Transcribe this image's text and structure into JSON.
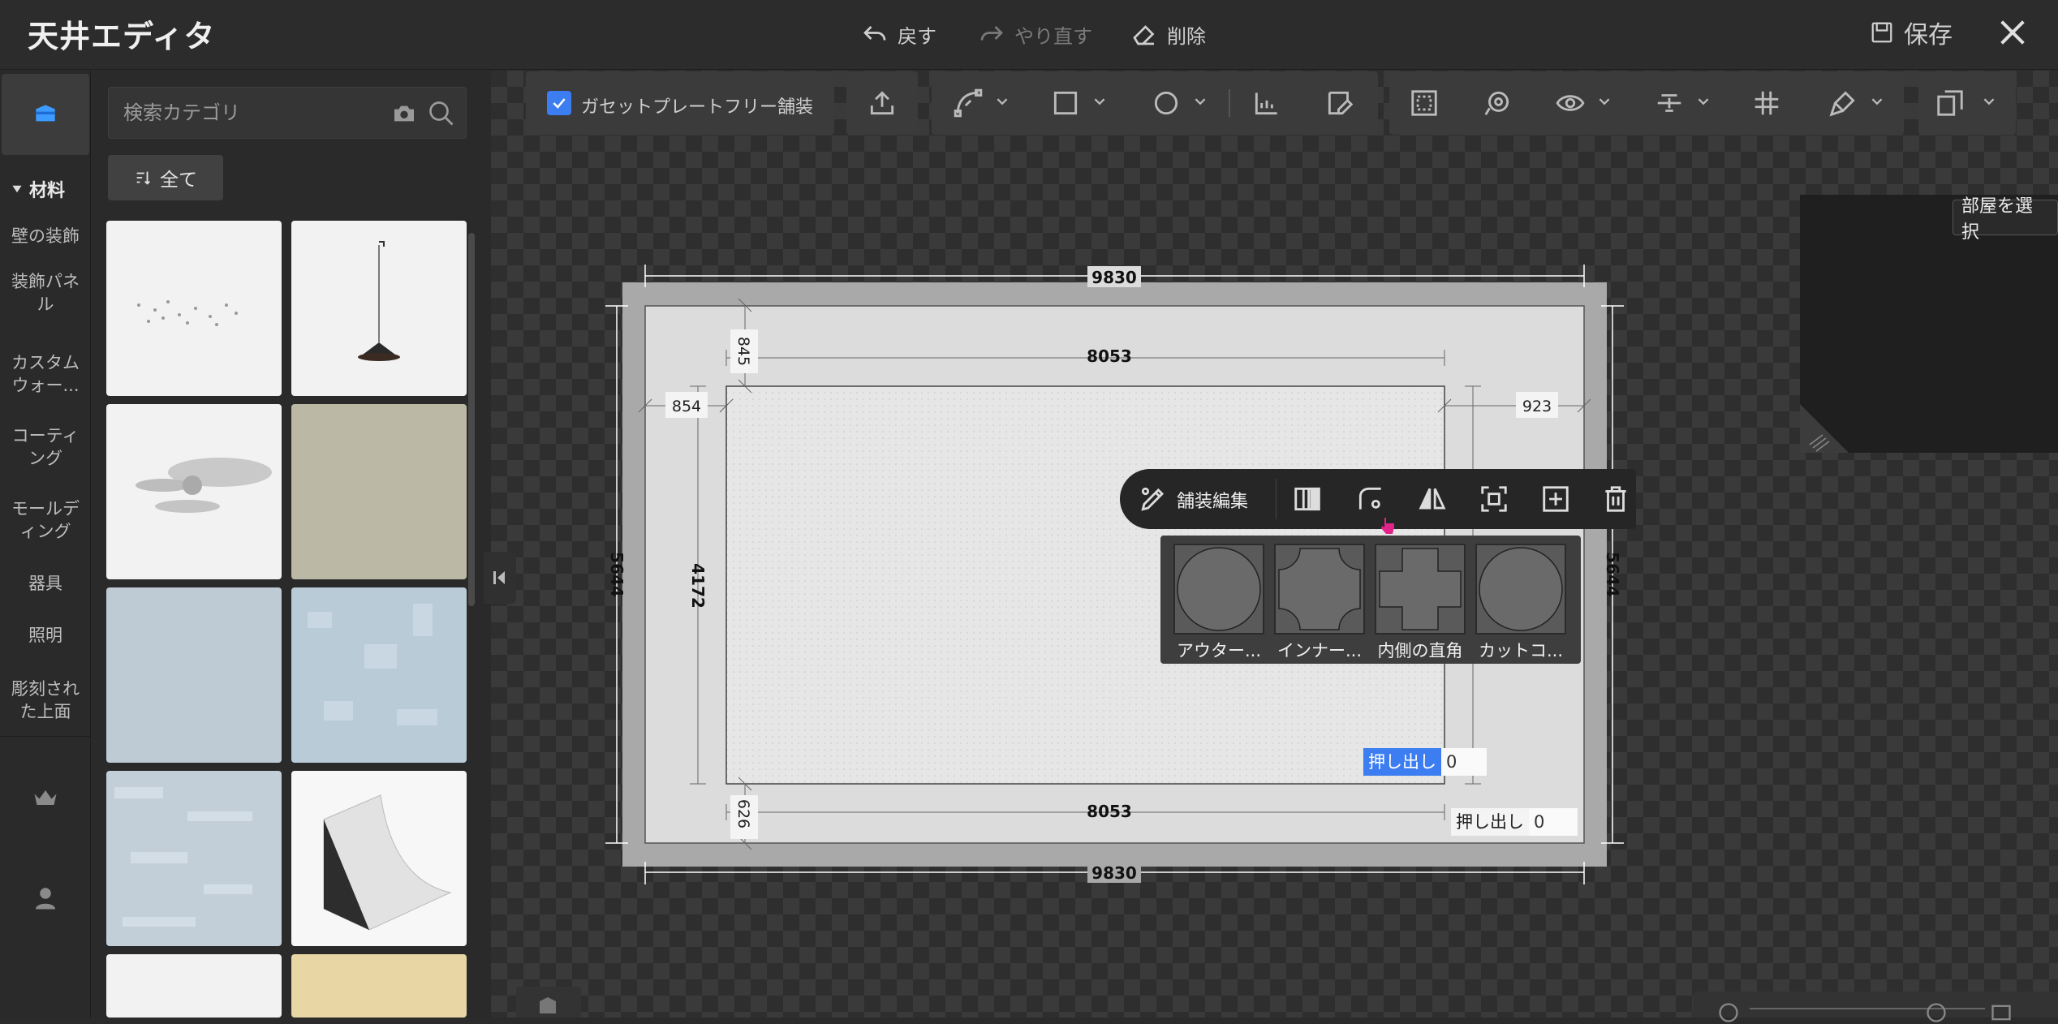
{
  "app": {
    "title": "天井エディタ",
    "undo_label": "戻す",
    "redo_label": "やり直す",
    "delete_label": "削除",
    "save_label": "保存"
  },
  "rail": {
    "heading": "材料",
    "items": [
      "壁の装飾",
      "装飾パネル",
      "カスタムウォー...",
      "コーティング",
      "モールディング",
      "器具",
      "照明",
      "彫刻された上面"
    ]
  },
  "catalog": {
    "search_placeholder": "検索カテゴリ",
    "filter_label": "全て"
  },
  "toolbar": {
    "gasset_label": "ガセットプレートフリー舗装",
    "gasset_checked": true
  },
  "room": {
    "select_label": "部屋を選択"
  },
  "dimensions": {
    "outer_width_top": "9830",
    "outer_width_bottom": "9830",
    "inner_width_top": "8053",
    "inner_width_bottom": "8053",
    "height_left": "5644",
    "height_right": "5644",
    "inner_height": "4172",
    "offset_top": "845",
    "offset_bottom": "626",
    "offset_left": "854",
    "offset_right": "923"
  },
  "edit_bar": {
    "label": "舗装編集"
  },
  "shape_options": [
    "アウター...",
    "インナー...",
    "内側の直角",
    "カットコ..."
  ],
  "extrude": {
    "inner_label": "押し出し",
    "inner_value": "0",
    "outer_label": "押し出し",
    "outer_value": "0"
  },
  "colors": {
    "accent": "#3d7df2",
    "background": "#2b2b2b",
    "panel": "#2a2a2a",
    "ceiling_outer": "#a9a9a9",
    "ceiling_inner": "#dcdcdc"
  }
}
